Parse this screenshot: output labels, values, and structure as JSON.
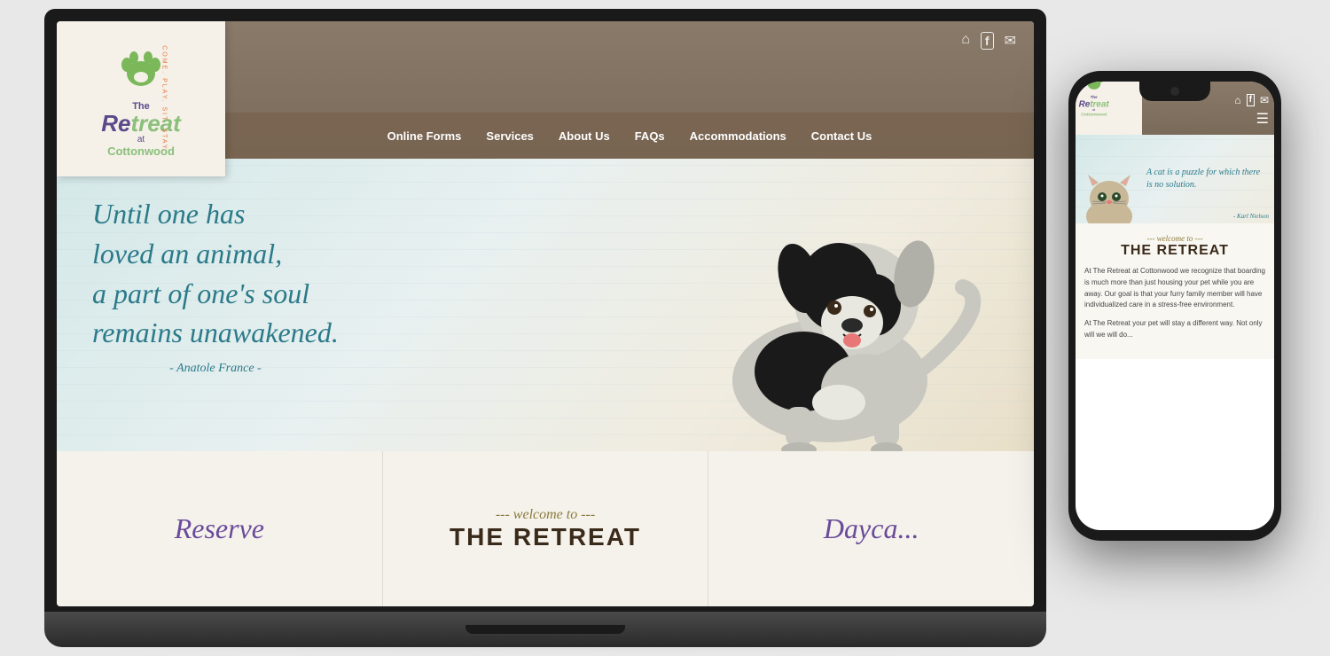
{
  "page": {
    "background_color": "#e8e8e8"
  },
  "laptop": {
    "website": {
      "logo": {
        "the_text": "The",
        "retreat_text": "Retreat",
        "at_text": "at",
        "cottonwood_text": "Cottonwood",
        "tagline": "COME. PLAY. SIT. STAY."
      },
      "top_icons": {
        "home_icon": "⌂",
        "facebook_icon": "f",
        "email_icon": "✉"
      },
      "nav": {
        "items": [
          {
            "label": "Online Forms",
            "active": false
          },
          {
            "label": "Services",
            "active": false
          },
          {
            "label": "About Us",
            "active": false
          },
          {
            "label": "FAQs",
            "active": false
          },
          {
            "label": "Accommodations",
            "active": false
          },
          {
            "label": "Contact Us",
            "active": false
          }
        ]
      },
      "hero": {
        "quote_line1": "Until one has",
        "quote_line2": "loved an animal,",
        "quote_line3": "a part of one's soul",
        "quote_line4": "remains unawakened.",
        "attribution": "- Anatole France -"
      },
      "bottom": {
        "reserve_label": "Reserve",
        "welcome_sub": "--- welcome to ---",
        "welcome_title": "THE RETREAT",
        "daycare_label": "Dayca..."
      }
    }
  },
  "phone": {
    "website": {
      "logo": {
        "the_text": "The",
        "retreat_text": "Retreat",
        "at_text": "at",
        "cottonwood_text": "Cottonwood"
      },
      "top_icons": {
        "home_icon": "⌂",
        "facebook_icon": "f",
        "email_icon": "✉"
      },
      "hamburger_icon": "☰",
      "hero": {
        "quote": "A cat is a puzzle for which there is no solution.",
        "attribution": "- Karl Nielson"
      },
      "content": {
        "welcome_sub": "--- welcome to ---",
        "welcome_title": "THE RETREAT",
        "body_text_1": "At The Retreat at Cottonwood we recognize that boarding is much more than just housing your pet while you are away. Our goal is that your furry family member will have individualized care in a stress-free environment.",
        "body_text_2": "At The Retreat your pet will stay a different way. Not only will we will do..."
      }
    }
  }
}
